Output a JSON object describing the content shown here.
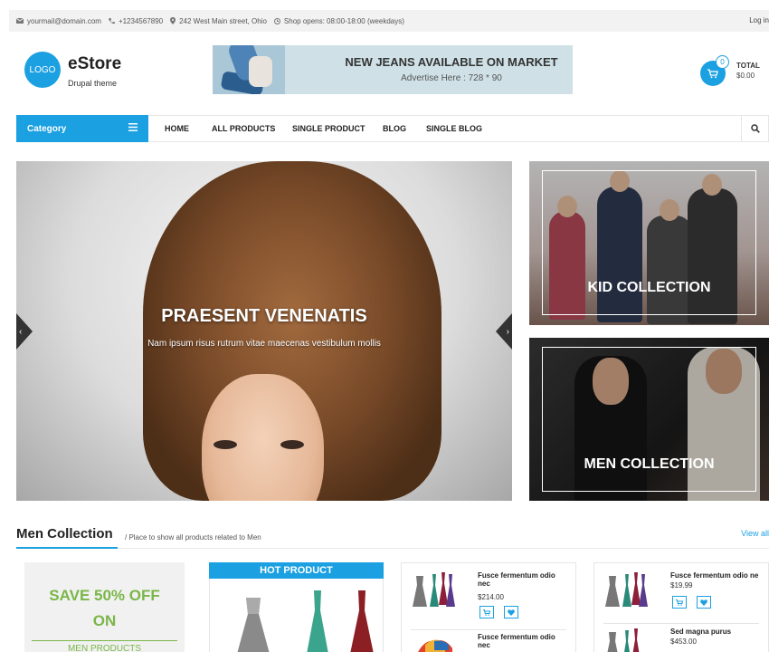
{
  "topbar": {
    "email": "yourmail@domain.com",
    "phone": "+1234567890",
    "address": "242 West Main street, Ohio",
    "hours": "Shop opens: 08:00-18:00 (weekdays)",
    "login": "Log in"
  },
  "header": {
    "logo": "LOGO",
    "brand": "eStore",
    "tagline": "Drupal theme",
    "banner_title": "NEW JEANS AVAILABLE ON MARKET",
    "banner_sub": "Advertise Here : 728 * 90",
    "cart_count": "0",
    "total_label": "TOTAL",
    "total_value": "$0.00"
  },
  "nav": {
    "category": "Category",
    "links": [
      "HOME",
      "ALL PRODUCTS",
      "SINGLE PRODUCT",
      "BLOG",
      "SINGLE BLOG"
    ]
  },
  "hero": {
    "title": "PRAESENT VENENATIS",
    "subtitle": "Nam ipsum risus rutrum vitae maecenas vestibulum mollis"
  },
  "collections": {
    "kid": "KID COLLECTION",
    "men": "MEN COLLECTION"
  },
  "section": {
    "title": "Men Collection",
    "subtitle": "/ Place to show all products related to Men",
    "view_all": "View all"
  },
  "promo": {
    "line1": "SAVE 50% OFF",
    "line2": "ON",
    "line3": "MEN PRODUCTS"
  },
  "hot": {
    "label": "HOT PRODUCT"
  },
  "products_col1": [
    {
      "name": "Fusce fermentum odio nec",
      "price": "$214.00"
    },
    {
      "name": "Fusce fermentum odio nec",
      "price": ""
    }
  ],
  "products_col2": [
    {
      "name": "Fusce fermentum odio ne",
      "price": "$19.99"
    },
    {
      "name": "Sed magna purus",
      "price": "$453.00"
    }
  ],
  "colors": {
    "accent": "#1ba0e1",
    "promo_green": "#7ab648"
  }
}
